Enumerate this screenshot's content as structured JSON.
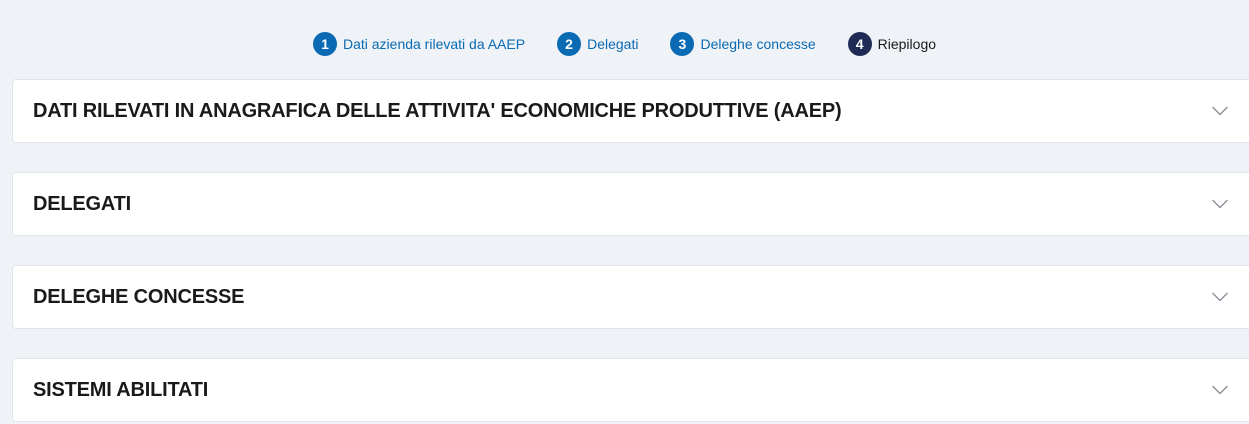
{
  "stepper": {
    "steps": [
      {
        "number": "1",
        "label": "Dati azienda rilevati da AAEP",
        "state": "link"
      },
      {
        "number": "2",
        "label": "Delegati",
        "state": "link"
      },
      {
        "number": "3",
        "label": "Deleghe concesse",
        "state": "link"
      },
      {
        "number": "4",
        "label": "Riepilogo",
        "state": "current"
      }
    ]
  },
  "accordion": {
    "sections": [
      {
        "title": "DATI RILEVATI IN ANAGRAFICA DELLE ATTIVITA' ECONOMICHE PRODUTTIVE (AAEP)",
        "icon": "chevron-down-icon"
      },
      {
        "title": "DELEGATI",
        "icon": "chevron-down-icon"
      },
      {
        "title": "DELEGHE CONCESSE",
        "icon": "chevron-down-icon"
      },
      {
        "title": "SISTEMI ABILITATI",
        "icon": "chevron-down-icon"
      }
    ]
  },
  "colors": {
    "page_background": "#eff2f6",
    "link_blue": "#0a6ab3",
    "current_step_navy": "#1f2b55",
    "current_step_text": "#1a1a1a",
    "panel_background": "#ffffff",
    "chevron": "#8a8f96"
  }
}
